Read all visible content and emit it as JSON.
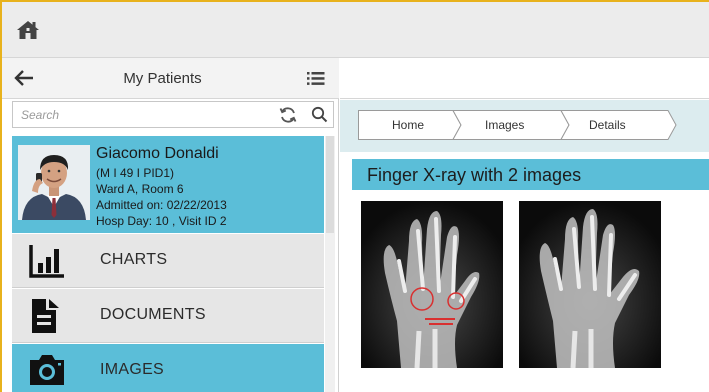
{
  "topbar": {
    "home_icon": "home-icon"
  },
  "sidebar": {
    "title": "My Patients",
    "back_icon": "arrow-left-icon",
    "list_icon": "list-icon",
    "search": {
      "placeholder": "Search",
      "value": ""
    },
    "patient": {
      "name": "Giacomo Donaldi",
      "id_line": "(M I 49 I PID1)",
      "ward": "Ward  A, Room 6",
      "admitted": "Admitted on: 02/22/2013",
      "hosp": "Hosp Day: 10 , Visit ID 2"
    },
    "nav": [
      {
        "label": "CHARTS",
        "icon": "bar-chart-icon"
      },
      {
        "label": "DOCUMENTS",
        "icon": "documents-icon"
      },
      {
        "label": "IMAGES",
        "icon": "camera-icon"
      }
    ]
  },
  "main": {
    "breadcrumbs": [
      "Home",
      "Images",
      "Details"
    ],
    "title": "Finger X-ray with 2 images",
    "images": [
      {
        "name": "xray-image-left"
      },
      {
        "name": "xray-image-right"
      }
    ]
  },
  "colors": {
    "accent": "#5bbed8",
    "frame": "#e8b21c",
    "breadcrumb_bar": "#dcecef",
    "nav_gray": "#e6e6e6"
  }
}
